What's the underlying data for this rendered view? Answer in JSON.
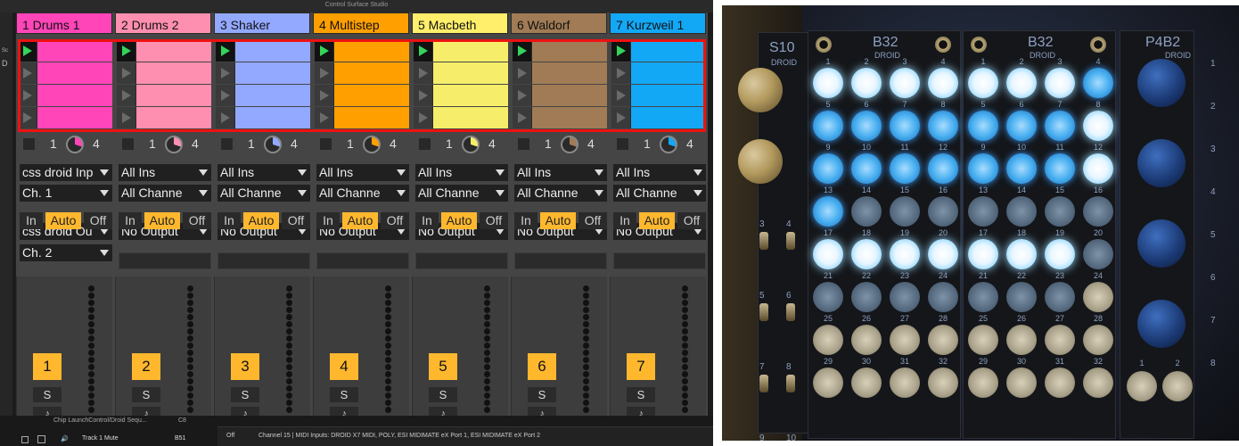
{
  "window_title": "Control Surface Studio",
  "side_strip": {
    "a": "Sc",
    "b": "D"
  },
  "tracks": [
    {
      "name": "1 Drums 1",
      "color": "#ff45b8",
      "clip_color": "#ff45b8",
      "knob_color": "#ff45b8",
      "input_type": "css droid Inp",
      "input_channel": "Ch. 1",
      "output_type": "css droid Ou",
      "output_channel": "Ch. 2",
      "number": "1"
    },
    {
      "name": "2 Drums 2",
      "color": "#ff8fb0",
      "clip_color": "#ff8fb0",
      "knob_color": "#ff8fb0",
      "input_type": "All Ins",
      "input_channel": "All Channe",
      "output_type": "No Output",
      "output_channel": "",
      "number": "2"
    },
    {
      "name": "3 Shaker",
      "color": "#93a8ff",
      "clip_color": "#93a8ff",
      "knob_color": "#93a8ff",
      "input_type": "All Ins",
      "input_channel": "All Channe",
      "output_type": "No Output",
      "output_channel": "",
      "number": "3"
    },
    {
      "name": "4 Multistep",
      "color": "#ff9f00",
      "clip_color": "#ff9f00",
      "knob_color": "#ff9f00",
      "input_type": "All Ins",
      "input_channel": "All Channe",
      "output_type": "No Output",
      "output_channel": "",
      "number": "4"
    },
    {
      "name": "5 Macbeth",
      "color": "#ffef6a",
      "clip_color": "#f6ee6a",
      "knob_color": "#f6ee6a",
      "input_type": "All Ins",
      "input_channel": "All Channe",
      "output_type": "No Output",
      "output_channel": "",
      "number": "5"
    },
    {
      "name": "6 Waldorf",
      "color": "#a07b55",
      "clip_color": "#a07b55",
      "knob_color": "#a07b55",
      "input_type": "All Ins",
      "input_channel": "All Channe",
      "output_type": "No Output",
      "output_channel": "",
      "number": "6"
    },
    {
      "name": "7 Kurzweil 1",
      "color": "#13a8f6",
      "clip_color": "#13a8f6",
      "knob_color": "#13a8f6",
      "input_type": "All Ins",
      "input_channel": "All Channe",
      "output_type": "No Output",
      "output_channel": "",
      "number": "7"
    }
  ],
  "mixer_labels": {
    "count_left": "1",
    "count_right": "4",
    "monitor_in": "In",
    "monitor_auto": "Auto",
    "monitor_off": "Off",
    "solo": "S",
    "record": "♪"
  },
  "browser": {
    "row1_label": "Chip LaunchControl/Droid Sequ...",
    "row1_value": "C8",
    "row2_label": "Track 1 Mute",
    "row2_value": "B51"
  },
  "status_bar": {
    "toggle": "Off",
    "message": "Channel 15 | MIDI Inputs: DROID X7 MIDI, POLY, ESI MIDIMATE eX Port 1, ESI MIDIMATE eX Port 2"
  },
  "hardware": {
    "s10_label": "S10",
    "s10_sub": "DROID",
    "b32_left_label": "B32",
    "b32_left_sub": "DROID",
    "b32_right_label": "B32",
    "b32_right_sub": "DROID",
    "p4b2_label": "P4B2",
    "p4b2_sub": "DROID",
    "p4b2_buttons": [
      "1",
      "2"
    ],
    "scale_numbers": [
      "1",
      "2",
      "3",
      "4",
      "5",
      "6",
      "7",
      "8"
    ],
    "s10_jack_numbers": [
      "3",
      "4",
      "5",
      "6",
      "7",
      "8",
      "9",
      "10"
    ],
    "left_grid_states": [
      "on",
      "on",
      "on",
      "on",
      "blue",
      "blue",
      "blue",
      "blue",
      "blue",
      "blue",
      "blue",
      "blue",
      "blue",
      "dim",
      "dim",
      "dim",
      "on",
      "on",
      "on",
      "on",
      "dim",
      "dim",
      "dim",
      "dim",
      "off",
      "off",
      "off",
      "off",
      "off",
      "off",
      "off",
      "off"
    ],
    "right_grid_states": [
      "on",
      "on",
      "on",
      "blue",
      "blue",
      "blue",
      "blue",
      "on",
      "blue",
      "blue",
      "blue",
      "on",
      "dim",
      "dim",
      "dim",
      "dim",
      "on",
      "on",
      "on",
      "dim",
      "dim",
      "dim",
      "dim",
      "off",
      "off",
      "off",
      "off",
      "off",
      "off",
      "off",
      "off",
      "off"
    ]
  }
}
